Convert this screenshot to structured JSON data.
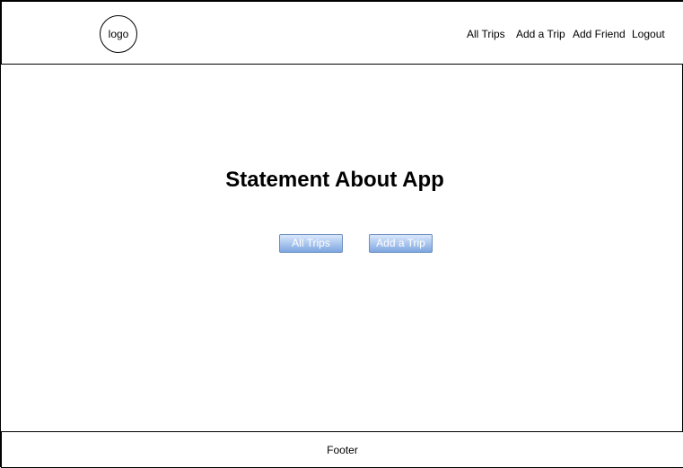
{
  "header": {
    "logo_text": "logo",
    "nav": {
      "all_trips": "All Trips",
      "add_trip": "Add a Trip",
      "add_friend": "Add Friend",
      "logout": "Logout"
    }
  },
  "main": {
    "statement": "Statement About App",
    "buttons": {
      "all_trips": "All Trips",
      "add_trip": "Add a Trip"
    }
  },
  "footer": {
    "text": "Footer"
  }
}
